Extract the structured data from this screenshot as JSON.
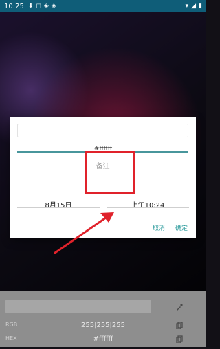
{
  "status": {
    "time": "10:25",
    "left_icons": [
      "download-icon",
      "notification-icon",
      "shield-icon",
      "shield-icon-2"
    ],
    "right_icons": [
      "wifi-icon",
      "signal-icon",
      "battery-icon"
    ]
  },
  "dialog": {
    "hex": "#ffffff",
    "note_placeholder": "备注",
    "date": "8月15日",
    "time": "上午10:24",
    "cancel": "取消",
    "confirm": "确定"
  },
  "bottom_panel": {
    "rgb_label": "RGB",
    "rgb_value": "255|255|255",
    "hex_label": "HEX",
    "hex_value": "#ffffff",
    "icons": [
      "eyedropper-icon",
      "copy-icon",
      "copy-icon-2"
    ]
  },
  "annotation": {
    "highlight_color": "#e0222b",
    "arrow_color": "#e0222b"
  }
}
